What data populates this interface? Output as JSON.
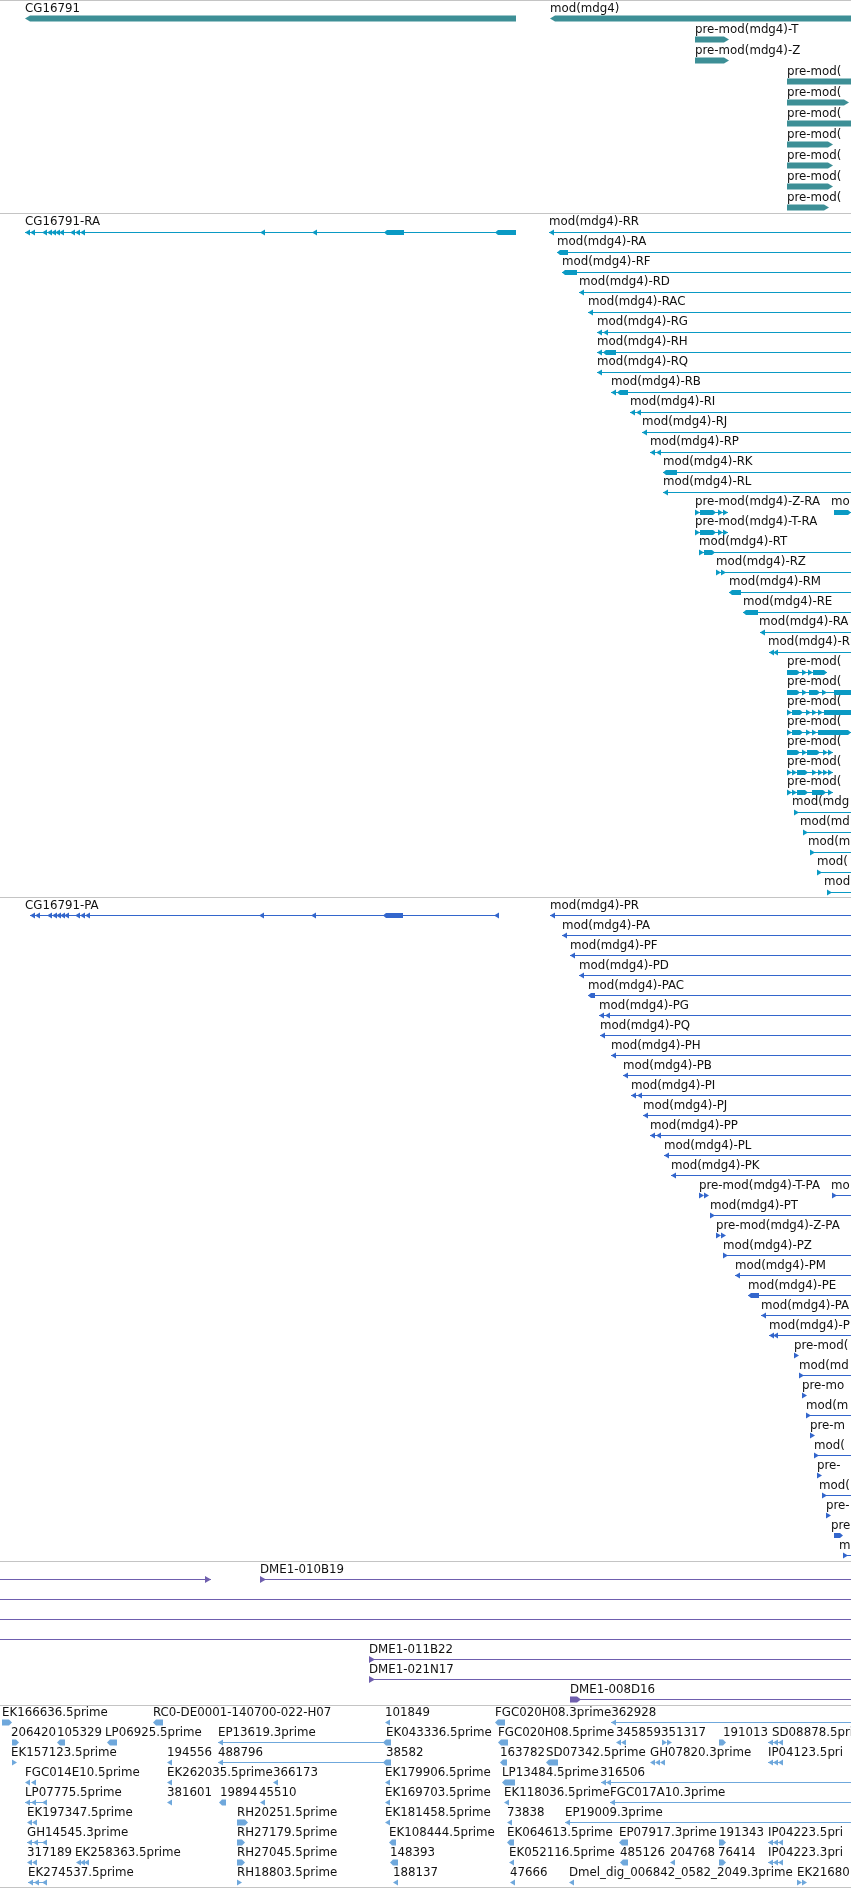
{
  "tracks": [
    {
      "kind": "gene",
      "color": "#3d8f96",
      "rows": [
        {
          "features": [
            {
              "label": "CG16791",
              "reverse": true
            },
            {
              "label": "mod(mdg4)",
              "reverse": true
            }
          ]
        },
        {
          "features": [
            {
              "label": "pre-mod(mdg4)-T",
              "reverse": false
            }
          ]
        },
        {
          "features": [
            {
              "label": "pre-mod(mdg4)-Z",
              "reverse": false
            }
          ]
        },
        {
          "features": [
            {
              "label": "pre-mod(",
              "reverse": false
            }
          ]
        },
        {
          "features": [
            {
              "label": "pre-mod(",
              "reverse": false
            }
          ]
        },
        {
          "features": [
            {
              "label": "pre-mod(",
              "reverse": false
            }
          ]
        },
        {
          "features": [
            {
              "label": "pre-mod(",
              "reverse": false
            }
          ]
        },
        {
          "features": [
            {
              "label": "pre-mod(",
              "reverse": false
            }
          ]
        },
        {
          "features": [
            {
              "label": "pre-mod(",
              "reverse": false
            }
          ]
        },
        {
          "features": [
            {
              "label": "pre-mod(",
              "reverse": false
            }
          ]
        }
      ]
    },
    {
      "kind": "transcript",
      "color": "#0a9ac4",
      "rows": [
        {
          "features": [
            {
              "label": "CG16791-RA",
              "reverse": true
            },
            {
              "label": "mod(mdg4)-RR",
              "reverse": true
            }
          ]
        },
        {
          "features": [
            {
              "label": "mod(mdg4)-RA",
              "reverse": true
            }
          ]
        },
        {
          "features": [
            {
              "label": "mod(mdg4)-RF",
              "reverse": true
            }
          ]
        },
        {
          "features": [
            {
              "label": "mod(mdg4)-RD",
              "reverse": true
            }
          ]
        },
        {
          "features": [
            {
              "label": "mod(mdg4)-RAC",
              "reverse": true
            }
          ]
        },
        {
          "features": [
            {
              "label": "mod(mdg4)-RG",
              "reverse": true
            }
          ]
        },
        {
          "features": [
            {
              "label": "mod(mdg4)-RH",
              "reverse": true
            }
          ]
        },
        {
          "features": [
            {
              "label": "mod(mdg4)-RQ",
              "reverse": true
            }
          ]
        },
        {
          "features": [
            {
              "label": "mod(mdg4)-RB",
              "reverse": true
            }
          ]
        },
        {
          "features": [
            {
              "label": "mod(mdg4)-RI",
              "reverse": true
            }
          ]
        },
        {
          "features": [
            {
              "label": "mod(mdg4)-RJ",
              "reverse": true
            }
          ]
        },
        {
          "features": [
            {
              "label": "mod(mdg4)-RP",
              "reverse": true
            }
          ]
        },
        {
          "features": [
            {
              "label": "mod(mdg4)-RK",
              "reverse": true
            }
          ]
        },
        {
          "features": [
            {
              "label": "mod(mdg4)-RL",
              "reverse": true
            }
          ]
        },
        {
          "features": [
            {
              "label": "pre-mod(mdg4)-Z-RA",
              "reverse": false
            },
            {
              "label": "mo",
              "reverse": false
            }
          ]
        },
        {
          "features": [
            {
              "label": "pre-mod(mdg4)-T-RA",
              "reverse": false
            }
          ]
        },
        {
          "features": [
            {
              "label": "mod(mdg4)-RT",
              "reverse": false
            }
          ]
        },
        {
          "features": [
            {
              "label": "mod(mdg4)-RZ",
              "reverse": false
            }
          ]
        },
        {
          "features": [
            {
              "label": "mod(mdg4)-RM",
              "reverse": true
            }
          ]
        },
        {
          "features": [
            {
              "label": "mod(mdg4)-RE",
              "reverse": true
            }
          ]
        },
        {
          "features": [
            {
              "label": "mod(mdg4)-RA",
              "reverse": true
            }
          ]
        },
        {
          "features": [
            {
              "label": "mod(mdg4)-R",
              "reverse": true
            }
          ]
        },
        {
          "features": [
            {
              "label": "pre-mod(",
              "reverse": false
            }
          ]
        },
        {
          "features": [
            {
              "label": "pre-mod(",
              "reverse": false
            }
          ]
        },
        {
          "features": [
            {
              "label": "pre-mod(",
              "reverse": false
            }
          ]
        },
        {
          "features": [
            {
              "label": "pre-mod(",
              "reverse": false
            }
          ]
        },
        {
          "features": [
            {
              "label": "pre-mod(",
              "reverse": false
            }
          ]
        },
        {
          "features": [
            {
              "label": "pre-mod(",
              "reverse": false
            }
          ]
        },
        {
          "features": [
            {
              "label": "pre-mod(",
              "reverse": false
            }
          ]
        },
        {
          "features": [
            {
              "label": "mod(mdg",
              "reverse": false
            }
          ]
        },
        {
          "features": [
            {
              "label": "mod(md",
              "reverse": false
            }
          ]
        },
        {
          "features": [
            {
              "label": "mod(m",
              "reverse": false
            }
          ]
        },
        {
          "features": [
            {
              "label": "mod(",
              "reverse": false
            }
          ]
        },
        {
          "features": [
            {
              "label": "mod",
              "reverse": false
            }
          ]
        }
      ]
    },
    {
      "kind": "transcript",
      "color": "#3366cc",
      "rows": [
        {
          "features": [
            {
              "label": "CG16791-PA",
              "reverse": true
            },
            {
              "label": "mod(mdg4)-PR",
              "reverse": true
            }
          ]
        },
        {
          "features": [
            {
              "label": "mod(mdg4)-PA",
              "reverse": true
            }
          ]
        },
        {
          "features": [
            {
              "label": "mod(mdg4)-PF",
              "reverse": true
            }
          ]
        },
        {
          "features": [
            {
              "label": "mod(mdg4)-PD",
              "reverse": true
            }
          ]
        },
        {
          "features": [
            {
              "label": "mod(mdg4)-PAC",
              "reverse": true
            }
          ]
        },
        {
          "features": [
            {
              "label": "mod(mdg4)-PG",
              "reverse": true
            }
          ]
        },
        {
          "features": [
            {
              "label": "mod(mdg4)-PQ",
              "reverse": true
            }
          ]
        },
        {
          "features": [
            {
              "label": "mod(mdg4)-PH",
              "reverse": true
            }
          ]
        },
        {
          "features": [
            {
              "label": "mod(mdg4)-PB",
              "reverse": true
            }
          ]
        },
        {
          "features": [
            {
              "label": "mod(mdg4)-PI",
              "reverse": true
            }
          ]
        },
        {
          "features": [
            {
              "label": "mod(mdg4)-PJ",
              "reverse": true
            }
          ]
        },
        {
          "features": [
            {
              "label": "mod(mdg4)-PP",
              "reverse": true
            }
          ]
        },
        {
          "features": [
            {
              "label": "mod(mdg4)-PL",
              "reverse": true
            }
          ]
        },
        {
          "features": [
            {
              "label": "mod(mdg4)-PK",
              "reverse": true
            }
          ]
        },
        {
          "features": [
            {
              "label": "pre-mod(mdg4)-T-PA",
              "reverse": false
            },
            {
              "label": "mo",
              "reverse": false
            }
          ]
        },
        {
          "features": [
            {
              "label": "mod(mdg4)-PT",
              "reverse": false
            }
          ]
        },
        {
          "features": [
            {
              "label": "pre-mod(mdg4)-Z-PA",
              "reverse": false
            }
          ]
        },
        {
          "features": [
            {
              "label": "mod(mdg4)-PZ",
              "reverse": false
            }
          ]
        },
        {
          "features": [
            {
              "label": "mod(mdg4)-PM",
              "reverse": true
            }
          ]
        },
        {
          "features": [
            {
              "label": "mod(mdg4)-PE",
              "reverse": true
            }
          ]
        },
        {
          "features": [
            {
              "label": "mod(mdg4)-PA",
              "reverse": true
            }
          ]
        },
        {
          "features": [
            {
              "label": "mod(mdg4)-P",
              "reverse": true
            }
          ]
        },
        {
          "features": [
            {
              "label": "pre-mod(",
              "reverse": false
            }
          ]
        },
        {
          "features": [
            {
              "label": "mod(md",
              "reverse": false
            }
          ]
        },
        {
          "features": [
            {
              "label": "pre-mo",
              "reverse": false
            }
          ]
        },
        {
          "features": [
            {
              "label": "mod(m",
              "reverse": false
            }
          ]
        },
        {
          "features": [
            {
              "label": "pre-m",
              "reverse": false
            }
          ]
        },
        {
          "features": [
            {
              "label": "mod(",
              "reverse": false
            }
          ]
        },
        {
          "features": [
            {
              "label": "pre-",
              "reverse": false
            }
          ]
        },
        {
          "features": [
            {
              "label": "mod(",
              "reverse": false
            }
          ]
        },
        {
          "features": [
            {
              "label": "pre-",
              "reverse": false
            }
          ]
        },
        {
          "features": [
            {
              "label": "pre",
              "reverse": false
            }
          ]
        },
        {
          "features": [
            {
              "label": "m",
              "reverse": false
            }
          ]
        }
      ]
    },
    {
      "kind": "clone",
      "color": "#6f5fae",
      "rows": [
        {
          "features": [
            {
              "reverse": false
            },
            {
              "label": "DME1-010B19",
              "reverse": false
            }
          ]
        },
        {
          "features": [
            {
              "spans_view": true
            }
          ]
        },
        {
          "features": [
            {
              "spans_view": true
            }
          ]
        },
        {
          "features": [
            {
              "spans_view": true
            }
          ]
        },
        {
          "features": [
            {
              "label": "DME1-011B22",
              "reverse": false
            }
          ]
        },
        {
          "features": [
            {
              "label": "DME1-021N17",
              "reverse": false
            }
          ]
        },
        {
          "features": [
            {
              "label": "DME1-008D16",
              "reverse": false
            }
          ]
        }
      ]
    },
    {
      "kind": "est",
      "color": "#6fa8dc",
      "rows": [
        {
          "features": [
            {
              "label": "EK166636.5prime",
              "reverse": false
            },
            {
              "label": "RC0-DE0001-140700-022-H07",
              "reverse": true
            },
            {
              "label": "101849",
              "reverse": true
            },
            {
              "label": "FGC020H08.3prime",
              "reverse": true
            },
            {
              "label": "362928",
              "reverse": true
            }
          ]
        },
        {
          "features": [
            {
              "label": "206420",
              "reverse": false
            },
            {
              "label": "105329",
              "reverse": true
            },
            {
              "label": "LP06925.5prime",
              "reverse": true
            },
            {
              "label": "EP13619.3prime",
              "reverse": true
            },
            {
              "label": "EK043336.5prime",
              "reverse": true
            },
            {
              "label": "FGC020H08.5prime",
              "reverse": true
            },
            {
              "label": "345859",
              "reverse": true
            },
            {
              "label": "351317",
              "reverse": false
            },
            {
              "label": "191013",
              "reverse": false
            },
            {
              "label": "SD08878.5pri",
              "reverse": true
            }
          ]
        },
        {
          "features": [
            {
              "label": "EK157123.5prime",
              "reverse": false
            },
            {
              "label": "194556",
              "reverse": true
            },
            {
              "label": "488796",
              "reverse": true
            },
            {
              "label": "38582",
              "reverse": true
            },
            {
              "label": "163782",
              "reverse": true
            },
            {
              "label": "SD07342.5prime",
              "reverse": true
            },
            {
              "label": "GH07820.3prime",
              "reverse": true
            },
            {
              "label": "IP04123.5pri",
              "reverse": true
            }
          ]
        },
        {
          "features": [
            {
              "label": "FGC014E10.5prime",
              "reverse": true
            },
            {
              "label": "EK262035.5prime",
              "reverse": true
            },
            {
              "label": "366173",
              "reverse": true
            },
            {
              "label": "EK179906.5prime",
              "reverse": true
            },
            {
              "label": "LP13484.5prime",
              "reverse": true
            },
            {
              "label": "316506",
              "reverse": true
            }
          ]
        },
        {
          "features": [
            {
              "label": "LP07775.5prime",
              "reverse": true
            },
            {
              "label": "381601",
              "reverse": true
            },
            {
              "label": "19894",
              "reverse": true
            },
            {
              "label": "45510",
              "reverse": true
            },
            {
              "label": "EK169703.5prime",
              "reverse": true
            },
            {
              "label": "EK118036.5prime",
              "reverse": true
            },
            {
              "label": "FGC017A10.3prime",
              "reverse": true
            }
          ]
        },
        {
          "features": [
            {
              "label": "EK197347.5prime",
              "reverse": true
            },
            {
              "label": "RH20251.5prime",
              "reverse": false
            },
            {
              "label": "EK181458.5prime",
              "reverse": true
            },
            {
              "label": "73838",
              "reverse": true
            },
            {
              "label": "EP19009.3prime",
              "reverse": true
            }
          ]
        },
        {
          "features": [
            {
              "label": "GH14545.3prime",
              "reverse": true
            },
            {
              "label": "RH27179.5prime",
              "reverse": false
            },
            {
              "label": "EK108444.5prime",
              "reverse": true
            },
            {
              "label": "EK064613.5prime",
              "reverse": true
            },
            {
              "label": "EP07917.3prime",
              "reverse": true
            },
            {
              "label": "191343",
              "reverse": false
            },
            {
              "label": "IP04223.5pri",
              "reverse": true
            }
          ]
        },
        {
          "features": [
            {
              "label": "317189",
              "reverse": true
            },
            {
              "label": "EK258363.5prime",
              "reverse": true
            },
            {
              "label": "RH27045.5prime",
              "reverse": false
            },
            {
              "label": "148393",
              "reverse": true
            },
            {
              "label": "EK052116.5prime",
              "reverse": true
            },
            {
              "label": "485126",
              "reverse": true
            },
            {
              "label": "204768",
              "reverse": true
            },
            {
              "label": "76414",
              "reverse": false
            },
            {
              "label": "IP04223.3pri",
              "reverse": true
            }
          ]
        },
        {
          "features": [
            {
              "label": "EK274537.5prime",
              "reverse": true
            },
            {
              "label": "RH18803.5prime",
              "reverse": false
            },
            {
              "label": "188137",
              "reverse": true
            },
            {
              "label": "47666",
              "reverse": true
            },
            {
              "label": "Dmel_dig_006842_0582_2049.3prime",
              "reverse": true
            },
            {
              "label": "EK21680",
              "reverse": false
            }
          ]
        }
      ]
    }
  ]
}
